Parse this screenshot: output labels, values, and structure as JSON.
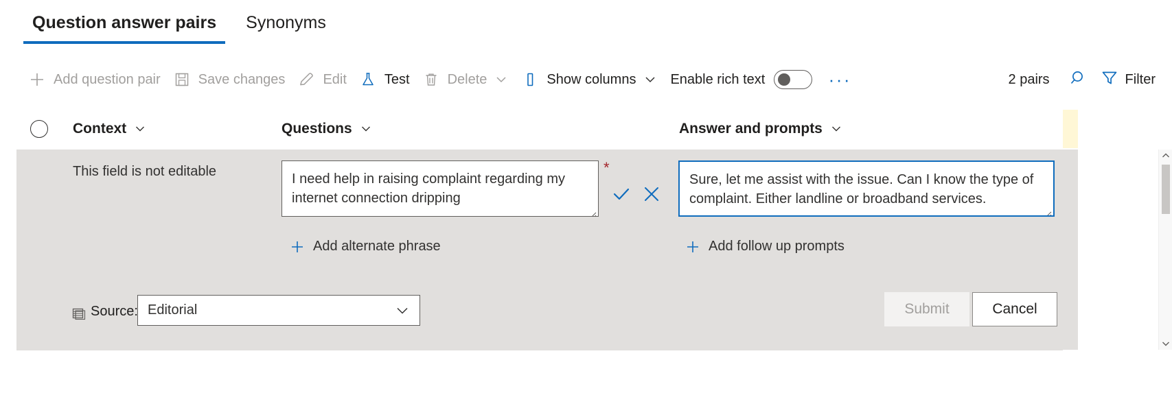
{
  "tabs": [
    {
      "label": "Question answer pairs",
      "active": true
    },
    {
      "label": "Synonyms",
      "active": false
    }
  ],
  "toolbar": {
    "add_question_pair": "Add question pair",
    "save_changes": "Save changes",
    "edit": "Edit",
    "test": "Test",
    "delete": "Delete",
    "show_columns": "Show columns",
    "enable_rich_text": "Enable rich text",
    "rich_text_toggle_state": "off",
    "overflow": "···",
    "pairs_count": "2 pairs",
    "filter": "Filter",
    "icons": {
      "add": "plus-icon",
      "save": "save-disk-icon",
      "edit": "pencil-icon",
      "test": "flask-icon",
      "delete": "trash-icon",
      "show_columns": "column-icon",
      "search": "search-icon",
      "filter": "filter-icon"
    }
  },
  "columns": [
    {
      "label": "Context"
    },
    {
      "label": "Questions"
    },
    {
      "label": "Answer and prompts"
    }
  ],
  "row": {
    "context_notice": "This field is not editable",
    "question_value": "I need help in raising complaint regarding my internet connection dripping",
    "question_required_marker": "*",
    "answer_value": "Sure, let me assist with the issue. Can I know the type of complaint. Either landline or broadband services.",
    "answer_focused": true,
    "add_alternate_phrase": "Add alternate phrase",
    "add_follow_up_prompts": "Add follow up prompts",
    "source_label": "Source:",
    "source_value": "Editorial",
    "source_options": [
      "Editorial"
    ],
    "submit_label": "Submit",
    "submit_disabled": true,
    "cancel_label": "Cancel"
  },
  "colors": {
    "accent": "#0f6cbd",
    "row_selected_bg": "#e1dfdd",
    "required_star": "#a4262c",
    "disabled_text": "#a19f9d"
  }
}
